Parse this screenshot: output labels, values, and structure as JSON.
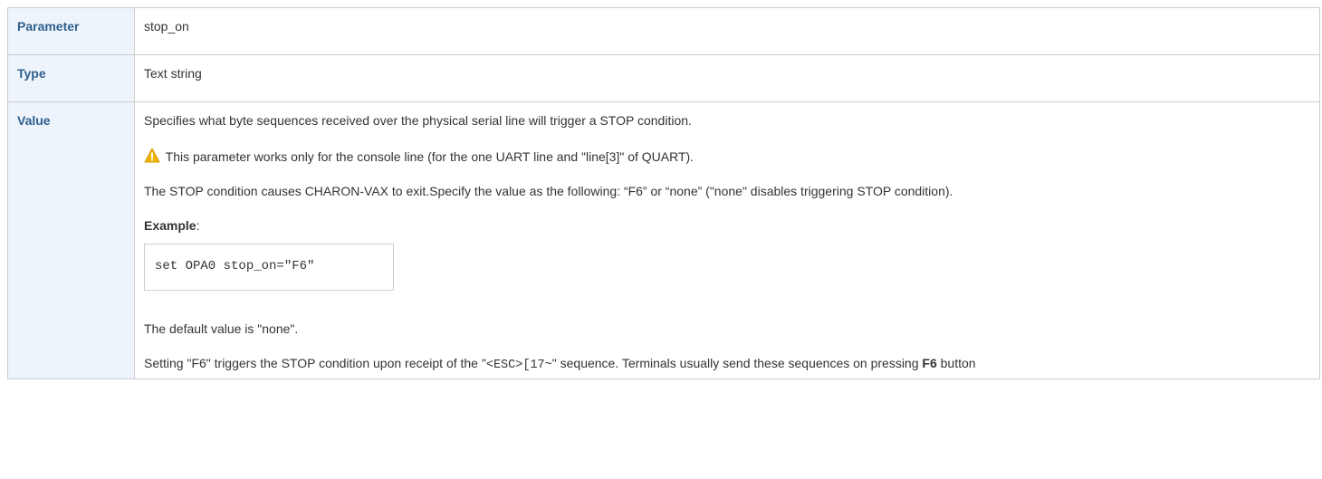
{
  "rows": {
    "parameter": {
      "label": "Parameter",
      "value": "stop_on"
    },
    "type": {
      "label": "Type",
      "value": "Text string"
    },
    "value": {
      "label": "Value",
      "description": "Specifies what byte sequences received over the physical serial line will trigger a STOP condition.",
      "warning_icon": "warning-triangle-icon",
      "warning_text": " This parameter works only for the console line (for the one UART line and \"line[3]\" of QUART).",
      "stop_text": "The STOP condition causes CHARON-VAX to exit.Specify the value as the following: “F6” or “none” (\"none\" disables triggering STOP condition).",
      "example_label": "Example",
      "example_colon": ":",
      "example_code": "set OPA0 stop_on=\"F6\"",
      "default_text": "The default value is \"none\".",
      "setting_prefix": "Setting \"F6\" triggers the STOP condition upon receipt of the \"",
      "setting_code": "<ESC>[17~",
      "setting_middle": "\" sequence. Terminals usually send these sequences on pressing ",
      "setting_bold": "F6",
      "setting_suffix": " button"
    }
  },
  "colors": {
    "header_bg": "#eef4fb",
    "header_text": "#2f5f8e",
    "border": "#cccccc",
    "warning": "#f0b400"
  }
}
